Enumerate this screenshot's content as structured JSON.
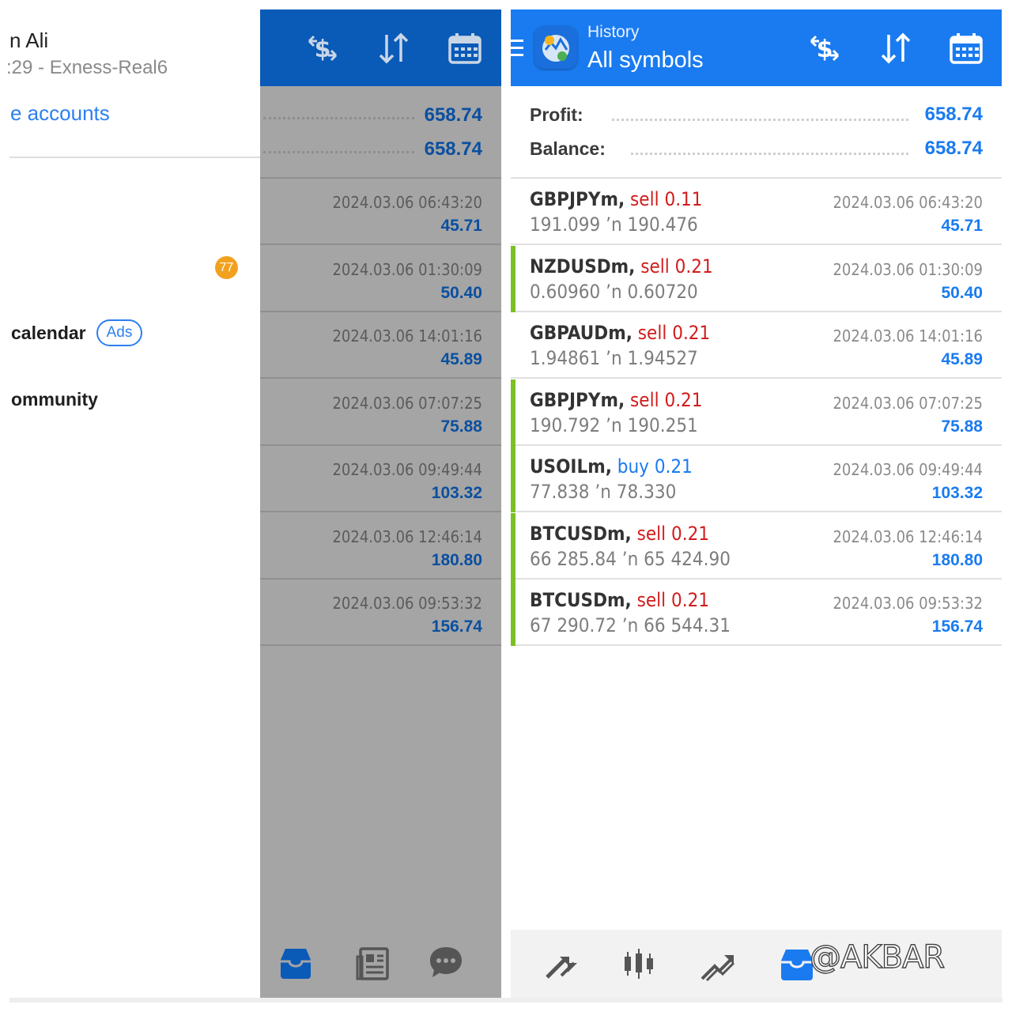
{
  "drawer": {
    "account_name": "n Ali",
    "account_server": ":29 - Exness-Real6",
    "manage_link": "e accounts",
    "badge_count": "77",
    "calendar_label": "calendar",
    "ads_label": "Ads",
    "community_label": "ommunity"
  },
  "background_screen": {
    "profit": "658.74",
    "balance": "658.74",
    "rows": [
      {
        "time": "2024.03.06 06:43:20",
        "profit": "45.71"
      },
      {
        "time": "2024.03.06 01:30:09",
        "profit": "50.40"
      },
      {
        "time": "2024.03.06 14:01:16",
        "profit": "45.89"
      },
      {
        "time": "2024.03.06 07:07:25",
        "profit": "75.88"
      },
      {
        "time": "2024.03.06 09:49:44",
        "profit": "103.32"
      },
      {
        "time": "2024.03.06 12:46:14",
        "profit": "180.80"
      },
      {
        "time": "2024.03.06 09:53:32",
        "profit": "156.74"
      }
    ]
  },
  "toolbar": {
    "subtitle": "History",
    "title": "All symbols",
    "icons": [
      "dollar-swap-icon",
      "sort-icon",
      "calendar-icon"
    ]
  },
  "summary": {
    "profit_label": "Profit:",
    "profit_value": "658.74",
    "balance_label": "Balance:",
    "balance_value": "658.74"
  },
  "trades": [
    {
      "symbol": "GBPJPYm,",
      "side": "sell",
      "volume": "0.11",
      "open": "191.099",
      "close": "190.476",
      "time": "2024.03.06 06:43:20",
      "profit": "45.71",
      "marked": false
    },
    {
      "symbol": "NZDUSDm,",
      "side": "sell",
      "volume": "0.21",
      "open": "0.60960",
      "close": "0.60720",
      "time": "2024.03.06 01:30:09",
      "profit": "50.40",
      "marked": true
    },
    {
      "symbol": "GBPAUDm,",
      "side": "sell",
      "volume": "0.21",
      "open": "1.94861",
      "close": "1.94527",
      "time": "2024.03.06 14:01:16",
      "profit": "45.89",
      "marked": false
    },
    {
      "symbol": "GBPJPYm,",
      "side": "sell",
      "volume": "0.21",
      "open": "190.792",
      "close": "190.251",
      "time": "2024.03.06 07:07:25",
      "profit": "75.88",
      "marked": true
    },
    {
      "symbol": "USOILm,",
      "side": "buy",
      "volume": "0.21",
      "open": "77.838",
      "close": "78.330",
      "time": "2024.03.06 09:49:44",
      "profit": "103.32",
      "marked": true
    },
    {
      "symbol": "BTCUSDm,",
      "side": "sell",
      "volume": "0.21",
      "open": "66 285.84",
      "close": "65 424.90",
      "time": "2024.03.06 12:46:14",
      "profit": "180.80",
      "marked": true
    },
    {
      "symbol": "BTCUSDm,",
      "side": "sell",
      "volume": "0.21",
      "open": "67 290.72",
      "close": "66 544.31",
      "time": "2024.03.06 09:53:32",
      "profit": "156.74",
      "marked": true
    }
  ],
  "arrow_glyph": "’n",
  "bottom_nav": [
    "quotes-icon",
    "chart-icon",
    "trade-icon",
    "history-icon"
  ],
  "watermark": "@AKBAR",
  "colors": {
    "toolbar_blue": "#1a7bf0",
    "sell_red": "#d21c1c",
    "buy_blue": "#1a7bf0",
    "marker_green": "#7cc024"
  }
}
